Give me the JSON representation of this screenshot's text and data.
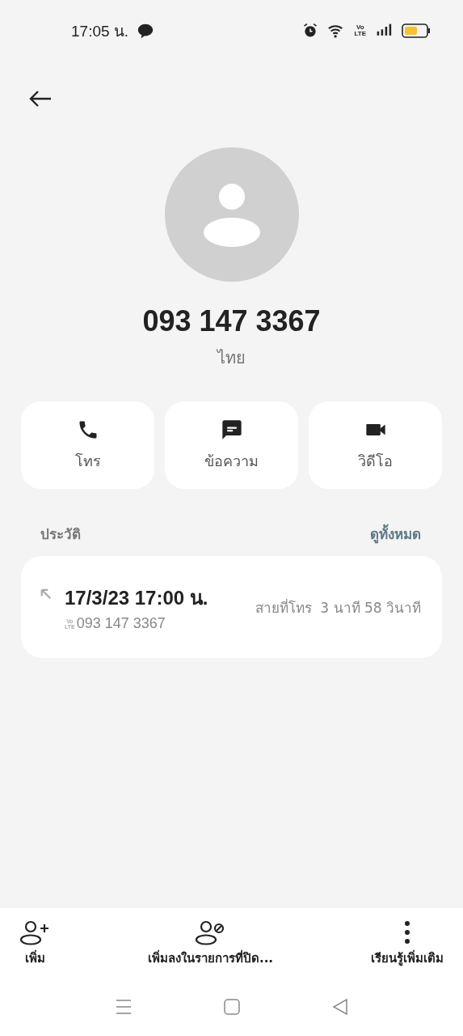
{
  "status_bar": {
    "time": "17:05 น.",
    "volte": [
      "Vo",
      "LTE"
    ]
  },
  "contact": {
    "number": "093 147 3367",
    "location": "ไทย"
  },
  "actions": [
    {
      "kind": "call",
      "label": "โทร"
    },
    {
      "kind": "message",
      "label": "ข้อความ"
    },
    {
      "kind": "video",
      "label": "วิดีโอ"
    }
  ],
  "history": {
    "title": "ประวัติ",
    "see_all": "ดูทั้งหมด",
    "calls": [
      {
        "kind": "outgoing",
        "datetime": "17/3/23 17:00 น.",
        "volte": [
          "Vo",
          "LTE"
        ],
        "number": "093 147 3367",
        "type": "สายที่โทร",
        "duration": "3 นาที 58 วินาที"
      }
    ]
  },
  "bottom_actions": [
    {
      "kind": "add",
      "label": "เพิ่ม"
    },
    {
      "kind": "block",
      "label": "เพิ่มลงในรายการที่ปิด..."
    },
    {
      "kind": "more",
      "label": "เรียนรู้เพิ่มเติม"
    }
  ],
  "nav_bar": [
    {
      "kind": "menu"
    },
    {
      "kind": "home"
    },
    {
      "kind": "back"
    }
  ]
}
